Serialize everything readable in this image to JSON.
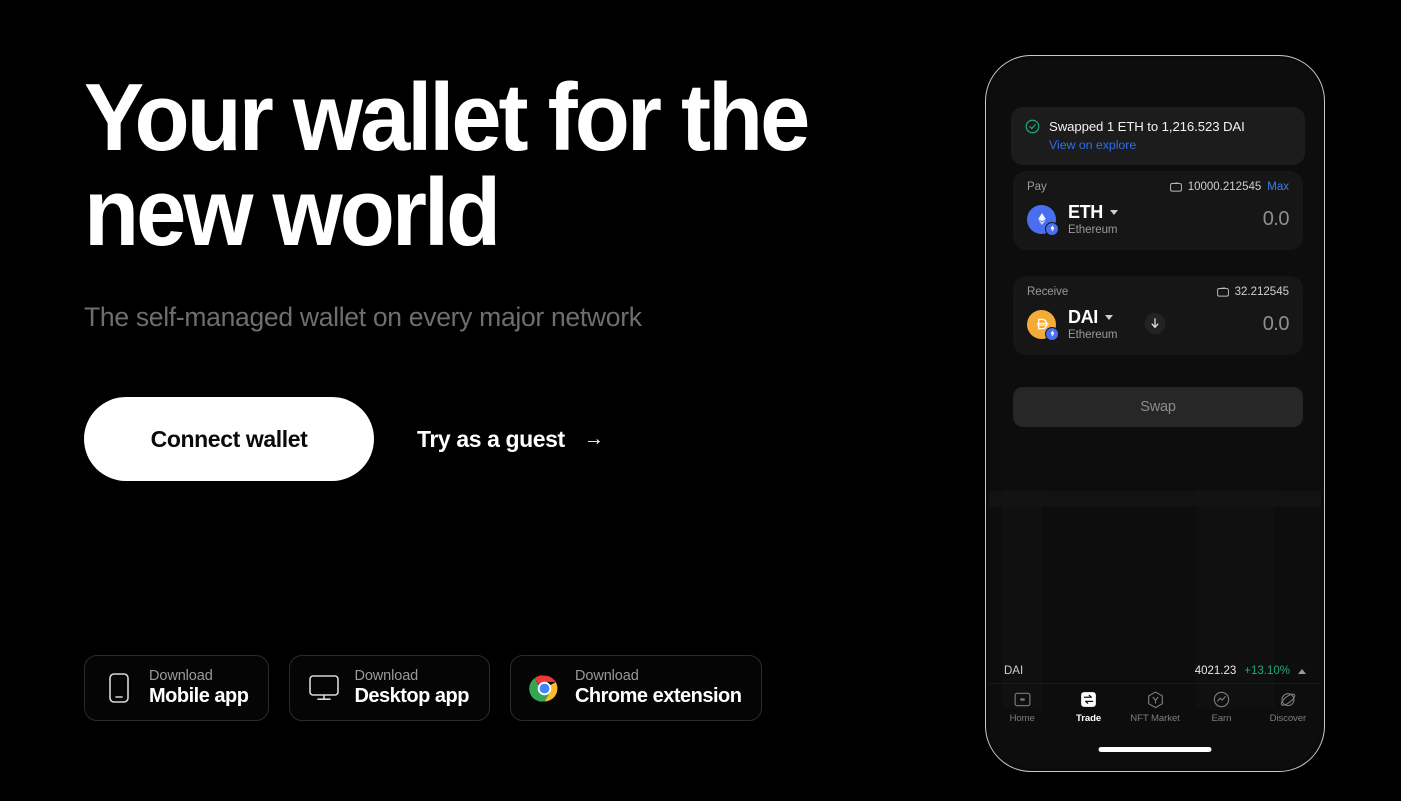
{
  "hero": {
    "heading": "Your wallet for the\nnew world",
    "subheading": "The self-managed wallet on every major network",
    "connect_label": "Connect wallet",
    "guest_label": "Try as a guest",
    "guest_arrow": "→"
  },
  "downloads": [
    {
      "small": "Download",
      "big": "Mobile app",
      "icon": "mobile-phone-icon"
    },
    {
      "small": "Download",
      "big": "Desktop app",
      "icon": "desktop-monitor-icon"
    },
    {
      "small": "Download",
      "big": "Chrome extension",
      "icon": "chrome-logo-icon"
    }
  ],
  "phone": {
    "notification": {
      "message": "Swapped 1 ETH to 1,216.523 DAI",
      "link": "View on explore",
      "status_icon": "check-circle-icon",
      "status_color": "#1ea97c",
      "link_color": "#2f6fe4"
    },
    "pay": {
      "label": "Pay",
      "balance": "10000.212545",
      "max_label": "Max",
      "symbol": "ETH",
      "network": "Ethereum",
      "amount": "0.0",
      "token_color": "#4a6ef0"
    },
    "receive": {
      "label": "Receive",
      "balance": "32.212545",
      "symbol": "DAI",
      "network": "Ethereum",
      "amount": "0.0",
      "token_color": "#f5ac37"
    },
    "swap_direction_icon": "arrow-down-icon",
    "swap_button_label": "Swap",
    "ticker": {
      "name": "DAI",
      "price": "4021.23",
      "change": "+13.10%",
      "change_color": "#1ea97c"
    },
    "nav": [
      {
        "label": "Home",
        "icon": "home-icon",
        "active": false
      },
      {
        "label": "Trade",
        "icon": "trade-icon",
        "active": true
      },
      {
        "label": "NFT Market",
        "icon": "nft-market-icon",
        "active": false
      },
      {
        "label": "Earn",
        "icon": "earn-icon",
        "active": false
      },
      {
        "label": "Discover",
        "icon": "discover-icon",
        "active": false
      }
    ]
  }
}
